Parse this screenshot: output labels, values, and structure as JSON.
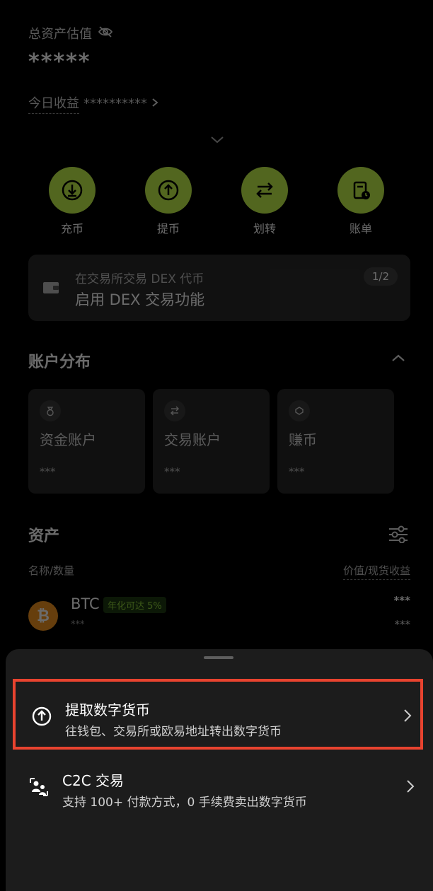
{
  "header": {
    "total_label": "总资产估值",
    "total_value": "*****",
    "today_label": "今日收益",
    "today_value": "**********"
  },
  "actions": [
    {
      "label": "充币",
      "icon": "deposit-icon"
    },
    {
      "label": "提币",
      "icon": "withdraw-icon"
    },
    {
      "label": "划转",
      "icon": "transfer-icon"
    },
    {
      "label": "账单",
      "icon": "bill-icon"
    }
  ],
  "dex_banner": {
    "line1": "在交易所交易 DEX 代币",
    "line2": "启用 DEX 交易功能",
    "pager": "1/2"
  },
  "accounts": {
    "title": "账户分布",
    "items": [
      {
        "name": "资金账户",
        "value": "***",
        "icon": "bag-icon"
      },
      {
        "name": "交易账户",
        "value": "***",
        "icon": "swap-icon"
      },
      {
        "name": "赚币",
        "value": "***",
        "icon": "earn-icon"
      }
    ]
  },
  "assets": {
    "title": "资产",
    "col_left": "名称/数量",
    "col_right": "价值/现货收益",
    "rows": [
      {
        "name": "BTC",
        "badge": "年化可达 5%",
        "qty": "***",
        "value": "***",
        "pnl": "***"
      }
    ]
  },
  "sheet": {
    "items": [
      {
        "title": "提取数字货币",
        "subtitle": "往钱包、交易所或欧易地址转出数字货币",
        "icon": "withdraw-icon"
      },
      {
        "title": "C2C 交易",
        "subtitle": "支持 100+ 付款方式，0 手续费卖出数字货币",
        "icon": "users-icon"
      }
    ]
  },
  "colors": {
    "accent": "#c4f24a",
    "highlight": "#e8432f",
    "btc": "#f39321",
    "background": "#000000",
    "sheet": "#1c1c1c"
  }
}
